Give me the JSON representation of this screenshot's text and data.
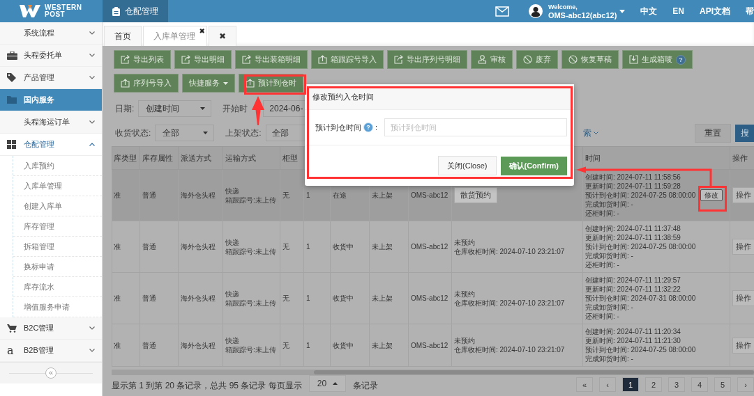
{
  "header": {
    "logo_line1": "WESTERN",
    "logo_line2": "POST",
    "module_tab": "仓配管理",
    "welcome": "Welcome,",
    "user": "OMS-abc12(abc12)",
    "links": [
      "中文",
      "EN",
      "API文档",
      "帮"
    ]
  },
  "sidebar": {
    "items": [
      {
        "label": "系统流程",
        "selected": false,
        "expanded": false
      },
      {
        "label": "头程委托单",
        "selected": false,
        "expanded": false
      },
      {
        "label": "产品管理",
        "selected": false,
        "expanded": false
      },
      {
        "label": "国内服务",
        "selected": true
      },
      {
        "label": "头程海运订单",
        "selected": false,
        "expanded": false
      },
      {
        "label": "仓配管理",
        "selected": false,
        "expanded": true,
        "children": [
          {
            "label": "入库预约",
            "selected": false
          },
          {
            "label": "入库单管理",
            "selected": false
          },
          {
            "label": "创建入库单",
            "selected": false
          },
          {
            "label": "库存管理",
            "selected": false
          },
          {
            "label": "拆箱管理",
            "selected": false
          },
          {
            "label": "换标申请",
            "selected": false
          },
          {
            "label": "库存流水",
            "selected": false
          },
          {
            "label": "增值服务申请",
            "selected": false
          }
        ]
      },
      {
        "label": "B2C管理",
        "selected": false,
        "expanded": false
      },
      {
        "label": "B2B管理",
        "selected": false,
        "expanded": false,
        "glyph": "a"
      }
    ],
    "collapse": "«"
  },
  "tabs": [
    {
      "label": "首页",
      "selected": false
    },
    {
      "label": "入库单管理",
      "selected": true,
      "close": "✖"
    },
    {
      "label": "✖",
      "selected": false
    }
  ],
  "toolbar": [
    [
      {
        "label": "导出列表",
        "kind": "export"
      },
      {
        "label": "导出明细",
        "kind": "export"
      },
      {
        "label": "导出装箱明细",
        "kind": "export"
      },
      {
        "label": "箱跟踪号导入",
        "kind": "import"
      },
      {
        "label": "导出序列号明细",
        "kind": "export"
      },
      {
        "label": "审核",
        "kind": "audit"
      },
      {
        "label": "废弃",
        "kind": "ban"
      },
      {
        "label": "恢复草稿",
        "kind": "ban"
      },
      {
        "label": "生成箱唛",
        "kind": "download",
        "help": "?"
      }
    ],
    [
      {
        "label": "序列号导入",
        "kind": "import"
      },
      {
        "label": "快捷服务",
        "kind": "dropdown"
      },
      {
        "label": "预计到仓时",
        "kind": "import"
      }
    ]
  ],
  "filters": [
    [
      {
        "kind": "label",
        "text": "日期:"
      },
      {
        "kind": "select",
        "value": "创建时间"
      },
      {
        "kind": "label",
        "text": "开始时"
      },
      {
        "kind": "input",
        "value": "2024-06-"
      }
    ],
    [
      {
        "kind": "label",
        "text": "收货状态:"
      },
      {
        "kind": "select",
        "value": "全部"
      },
      {
        "kind": "label",
        "text": "上架状态:"
      },
      {
        "kind": "input",
        "value": "全部"
      }
    ]
  ],
  "more_search": "索",
  "reset": "重置",
  "search": "搜",
  "table": {
    "columns": [
      {
        "label": "库类型"
      },
      {
        "label": "库存属性"
      },
      {
        "label": "派送方式"
      },
      {
        "label": "运输方式"
      },
      {
        "label": "柜型"
      },
      {},
      {},
      {},
      {},
      {},
      {
        "label": "时间"
      },
      {
        "label": "操作"
      }
    ],
    "rows": [
      {
        "selected": true,
        "type": "准",
        "attr": "普通",
        "delivery": "海外仓头程",
        "transport": [
          "快递",
          "箱跟踪号:未上传"
        ],
        "cabinet": "无",
        "qty": "1",
        "status": "在途",
        "shelf": "未上架",
        "customer": "OMS-abc12",
        "reservation": {
          "kind": "button",
          "label": "散货预约"
        },
        "times": [
          "创建时间: 2024-07-11 11:58:56",
          "更新时间: 2024-07-11 11:59:28",
          "预计到仓时间: 2024-07-25 08:00:00",
          "完成卸货时间: -",
          "还柜时间: -"
        ],
        "edit": "修改",
        "action": "操作"
      },
      {
        "selected": false,
        "type": "准",
        "attr": "普通",
        "delivery": "海外仓头程",
        "transport": [
          "快递",
          "箱跟踪号:未上传"
        ],
        "cabinet": "无",
        "qty": "1",
        "status": "收货中",
        "shelf": "未上架",
        "customer": "OMS-abc12",
        "reservation": {
          "kind": "text",
          "lines": [
            "未预约",
            "仓库收柜时间: 2024-07-10 23:21:07"
          ]
        },
        "times": [
          "创建时间: 2024-07-11 11:37:48",
          "更新时间: 2024-07-11 11:38:59",
          "预计到仓时间: 2024-07-25 08:00:00",
          "完成卸货时间: -",
          "还柜时间: -"
        ],
        "action": "操作"
      },
      {
        "selected": false,
        "type": "准",
        "attr": "普通",
        "delivery": "海外仓头程",
        "transport": [
          "快递",
          "箱跟踪号:未上传"
        ],
        "cabinet": "无",
        "qty": "1",
        "status": "收货中",
        "shelf": "未上架",
        "customer": "OMS-abc12",
        "reservation": {
          "kind": "text",
          "lines": [
            "未预约",
            "仓库收柜时间: 2024-07-10 23:21:07"
          ]
        },
        "times": [
          "创建时间: 2024-07-11 11:29:57",
          "更新时间: 2024-07-11 11:32:22",
          "预计到仓时间: 2024-07-31 08:00:00",
          "完成卸货时间: -",
          "还柜时间: -"
        ],
        "action": "操作"
      },
      {
        "selected": false,
        "type": "准",
        "attr": "普通",
        "delivery": "海外仓头程",
        "transport": [
          "快递",
          "箱跟踪号:未上传"
        ],
        "cabinet": "无",
        "qty": "1",
        "status": "收货中",
        "shelf": "未上架",
        "customer": "OMS-abc12",
        "reservation": {
          "kind": "text",
          "lines": [
            "未预约",
            "仓库收柜时间: 2024-07-10 23:21:07"
          ]
        },
        "times": [
          "创建时间: 2024-07-11 11:20:34",
          "更新时间: 2024-07-11 11:21:30",
          "预计到仓时间: 2024-07-25 08:00:00",
          "完成卸货时间: -"
        ],
        "action": "操作"
      }
    ]
  },
  "footer": {
    "summary": "显示第 1 到第 20 条记录，总共 95 条记录 每页显示",
    "page_size": "20",
    "suffix": "条记录"
  },
  "pagination": [
    {
      "label": "«",
      "selected": false
    },
    {
      "label": "‹",
      "selected": false
    },
    {
      "label": "1",
      "selected": true
    },
    {
      "label": "2",
      "selected": false
    },
    {
      "label": "3",
      "selected": false
    },
    {
      "label": "4",
      "selected": false
    },
    {
      "label": "5",
      "selected": false
    },
    {
      "label": "›",
      "selected": false
    }
  ],
  "dialog": {
    "title": "修改预约入仓时间",
    "field_label": "预计到仓时间",
    "help": "?",
    "colon": ":",
    "placeholder": "预计到仓时间",
    "close": "关闭(Close)",
    "confirm": "确认(Confirm)"
  }
}
